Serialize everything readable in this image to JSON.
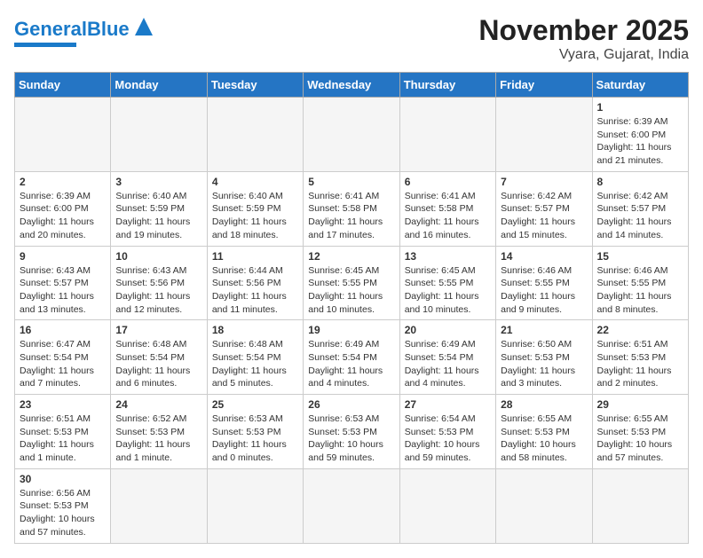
{
  "header": {
    "logo_general": "General",
    "logo_blue": "Blue",
    "title": "November 2025",
    "subtitle": "Vyara, Gujarat, India"
  },
  "days_of_week": [
    "Sunday",
    "Monday",
    "Tuesday",
    "Wednesday",
    "Thursday",
    "Friday",
    "Saturday"
  ],
  "weeks": [
    [
      {
        "day": "",
        "info": ""
      },
      {
        "day": "",
        "info": ""
      },
      {
        "day": "",
        "info": ""
      },
      {
        "day": "",
        "info": ""
      },
      {
        "day": "",
        "info": ""
      },
      {
        "day": "",
        "info": ""
      },
      {
        "day": "1",
        "info": "Sunrise: 6:39 AM\nSunset: 6:00 PM\nDaylight: 11 hours\nand 21 minutes."
      }
    ],
    [
      {
        "day": "2",
        "info": "Sunrise: 6:39 AM\nSunset: 6:00 PM\nDaylight: 11 hours\nand 20 minutes."
      },
      {
        "day": "3",
        "info": "Sunrise: 6:40 AM\nSunset: 5:59 PM\nDaylight: 11 hours\nand 19 minutes."
      },
      {
        "day": "4",
        "info": "Sunrise: 6:40 AM\nSunset: 5:59 PM\nDaylight: 11 hours\nand 18 minutes."
      },
      {
        "day": "5",
        "info": "Sunrise: 6:41 AM\nSunset: 5:58 PM\nDaylight: 11 hours\nand 17 minutes."
      },
      {
        "day": "6",
        "info": "Sunrise: 6:41 AM\nSunset: 5:58 PM\nDaylight: 11 hours\nand 16 minutes."
      },
      {
        "day": "7",
        "info": "Sunrise: 6:42 AM\nSunset: 5:57 PM\nDaylight: 11 hours\nand 15 minutes."
      },
      {
        "day": "8",
        "info": "Sunrise: 6:42 AM\nSunset: 5:57 PM\nDaylight: 11 hours\nand 14 minutes."
      }
    ],
    [
      {
        "day": "9",
        "info": "Sunrise: 6:43 AM\nSunset: 5:57 PM\nDaylight: 11 hours\nand 13 minutes."
      },
      {
        "day": "10",
        "info": "Sunrise: 6:43 AM\nSunset: 5:56 PM\nDaylight: 11 hours\nand 12 minutes."
      },
      {
        "day": "11",
        "info": "Sunrise: 6:44 AM\nSunset: 5:56 PM\nDaylight: 11 hours\nand 11 minutes."
      },
      {
        "day": "12",
        "info": "Sunrise: 6:45 AM\nSunset: 5:55 PM\nDaylight: 11 hours\nand 10 minutes."
      },
      {
        "day": "13",
        "info": "Sunrise: 6:45 AM\nSunset: 5:55 PM\nDaylight: 11 hours\nand 10 minutes."
      },
      {
        "day": "14",
        "info": "Sunrise: 6:46 AM\nSunset: 5:55 PM\nDaylight: 11 hours\nand 9 minutes."
      },
      {
        "day": "15",
        "info": "Sunrise: 6:46 AM\nSunset: 5:55 PM\nDaylight: 11 hours\nand 8 minutes."
      }
    ],
    [
      {
        "day": "16",
        "info": "Sunrise: 6:47 AM\nSunset: 5:54 PM\nDaylight: 11 hours\nand 7 minutes."
      },
      {
        "day": "17",
        "info": "Sunrise: 6:48 AM\nSunset: 5:54 PM\nDaylight: 11 hours\nand 6 minutes."
      },
      {
        "day": "18",
        "info": "Sunrise: 6:48 AM\nSunset: 5:54 PM\nDaylight: 11 hours\nand 5 minutes."
      },
      {
        "day": "19",
        "info": "Sunrise: 6:49 AM\nSunset: 5:54 PM\nDaylight: 11 hours\nand 4 minutes."
      },
      {
        "day": "20",
        "info": "Sunrise: 6:49 AM\nSunset: 5:54 PM\nDaylight: 11 hours\nand 4 minutes."
      },
      {
        "day": "21",
        "info": "Sunrise: 6:50 AM\nSunset: 5:53 PM\nDaylight: 11 hours\nand 3 minutes."
      },
      {
        "day": "22",
        "info": "Sunrise: 6:51 AM\nSunset: 5:53 PM\nDaylight: 11 hours\nand 2 minutes."
      }
    ],
    [
      {
        "day": "23",
        "info": "Sunrise: 6:51 AM\nSunset: 5:53 PM\nDaylight: 11 hours\nand 1 minute."
      },
      {
        "day": "24",
        "info": "Sunrise: 6:52 AM\nSunset: 5:53 PM\nDaylight: 11 hours\nand 1 minute."
      },
      {
        "day": "25",
        "info": "Sunrise: 6:53 AM\nSunset: 5:53 PM\nDaylight: 11 hours\nand 0 minutes."
      },
      {
        "day": "26",
        "info": "Sunrise: 6:53 AM\nSunset: 5:53 PM\nDaylight: 10 hours\nand 59 minutes."
      },
      {
        "day": "27",
        "info": "Sunrise: 6:54 AM\nSunset: 5:53 PM\nDaylight: 10 hours\nand 59 minutes."
      },
      {
        "day": "28",
        "info": "Sunrise: 6:55 AM\nSunset: 5:53 PM\nDaylight: 10 hours\nand 58 minutes."
      },
      {
        "day": "29",
        "info": "Sunrise: 6:55 AM\nSunset: 5:53 PM\nDaylight: 10 hours\nand 57 minutes."
      }
    ],
    [
      {
        "day": "30",
        "info": "Sunrise: 6:56 AM\nSunset: 5:53 PM\nDaylight: 10 hours\nand 57 minutes."
      },
      {
        "day": "",
        "info": ""
      },
      {
        "day": "",
        "info": ""
      },
      {
        "day": "",
        "info": ""
      },
      {
        "day": "",
        "info": ""
      },
      {
        "day": "",
        "info": ""
      },
      {
        "day": "",
        "info": ""
      }
    ]
  ]
}
